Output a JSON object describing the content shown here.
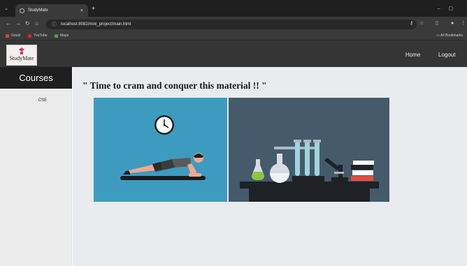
{
  "browser": {
    "tab_title": "StudyMate",
    "tab_close": "×",
    "new_tab": "+",
    "url": "localhost:8082/mini_project/main.html",
    "bookmarks": [
      {
        "label": "Gmail",
        "color": "#d64541"
      },
      {
        "label": "YouTube",
        "color": "#e02424"
      },
      {
        "label": "Maps",
        "color": "#34a853"
      }
    ],
    "all_bookmarks": "All Bookmarks"
  },
  "header": {
    "logo_text": "StudyMate",
    "nav": {
      "home": "Home",
      "logout": "Logout"
    }
  },
  "sidebar": {
    "title": "Courses",
    "items": [
      {
        "label": "CSE"
      }
    ]
  },
  "main": {
    "heading": "\" Time to cram and conquer this material !! \""
  },
  "colors": {
    "chrome_dark": "#1f1f1f",
    "header_bg": "#353535",
    "sidebar_head": "#1f1f1f",
    "panel_left": "#3d9bc0",
    "panel_right": "#455a6b",
    "content_bg": "#e9ebee"
  }
}
